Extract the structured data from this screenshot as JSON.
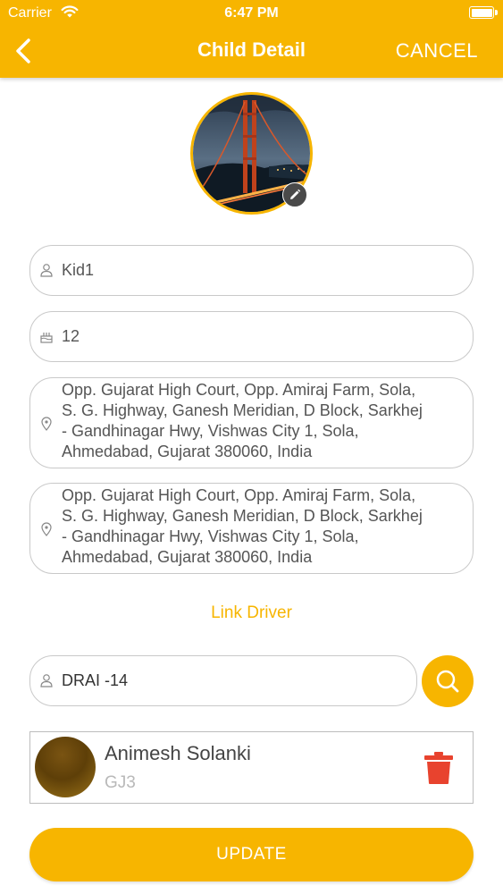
{
  "status_bar": {
    "carrier": "Carrier",
    "time": "6:47 PM"
  },
  "header": {
    "title": "Child Detail",
    "cancel_label": "CANCEL"
  },
  "form": {
    "name": "Kid1",
    "age": "12",
    "pickup_address": [
      "Opp. Gujarat High Court, Opp. Amiraj Farm, Sola,",
      "S. G. Highway, Ganesh Meridian, D Block, Sarkhej",
      "- Gandhinagar Hwy, Vishwas City 1, Sola,",
      "Ahmedabad, Gujarat 380060, India"
    ],
    "drop_address": [
      "Opp. Gujarat High Court, Opp. Amiraj Farm, Sola,",
      "S. G. Highway, Ganesh Meridian, D Block, Sarkhej",
      "- Gandhinagar Hwy, Vishwas City 1, Sola,",
      "Ahmedabad, Gujarat 380060, India"
    ]
  },
  "link_driver_label": "Link Driver",
  "driver_search": {
    "value": "DRAI -14"
  },
  "driver": {
    "name": "Animesh Solanki",
    "code": "GJ3"
  },
  "update_label": "UPDATE",
  "colors": {
    "accent": "#f7b500",
    "delete": "#e8432e"
  },
  "icons": [
    "back-chevron-icon",
    "wifi-icon",
    "battery-icon",
    "pencil-icon",
    "user-icon",
    "cake-icon",
    "location-pin-icon",
    "search-icon",
    "trash-icon"
  ]
}
